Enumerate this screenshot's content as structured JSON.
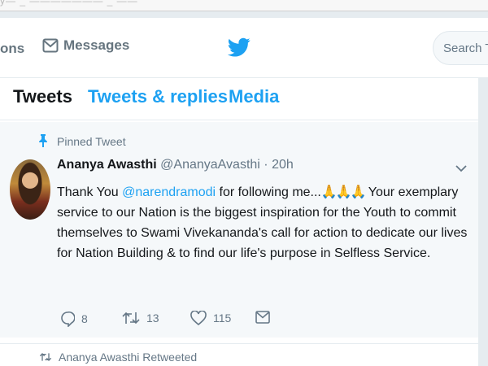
{
  "browser": {
    "strip_text": "y— _  ——————— _ ——  "
  },
  "header": {
    "notifications_label": "ons",
    "messages_label": "Messages",
    "search_placeholder": "Search Twi"
  },
  "tabs": [
    {
      "label": "Tweets",
      "active": true
    },
    {
      "label": "Tweets & replies",
      "active": false
    },
    {
      "label": "Media",
      "active": false
    }
  ],
  "pinned_tweet": {
    "pinned_label": "Pinned Tweet",
    "author": "Ananya Awasthi",
    "handle": "@AnanyaAvasthi",
    "separator": "·",
    "time": "20h",
    "text_before": "Thank You ",
    "mention": "@narendramodi",
    "text_mid": " for following me...",
    "emoji": "🙏🙏🙏",
    "text_after": " Your exemplary service to our Nation is the biggest inspiration for the Youth to commit themselves to Swami Vivekananda's call for action to dedicate our lives for Nation Building & to find our life's purpose in Selfless Service.",
    "reply_count": "8",
    "retweet_count": "13",
    "like_count": "115"
  },
  "next_item": {
    "retweet_note": "Ananya Awasthi Retweeted"
  },
  "colors": {
    "accent": "#1da1f2",
    "muted": "#657786",
    "background": "#e6ecf0"
  }
}
